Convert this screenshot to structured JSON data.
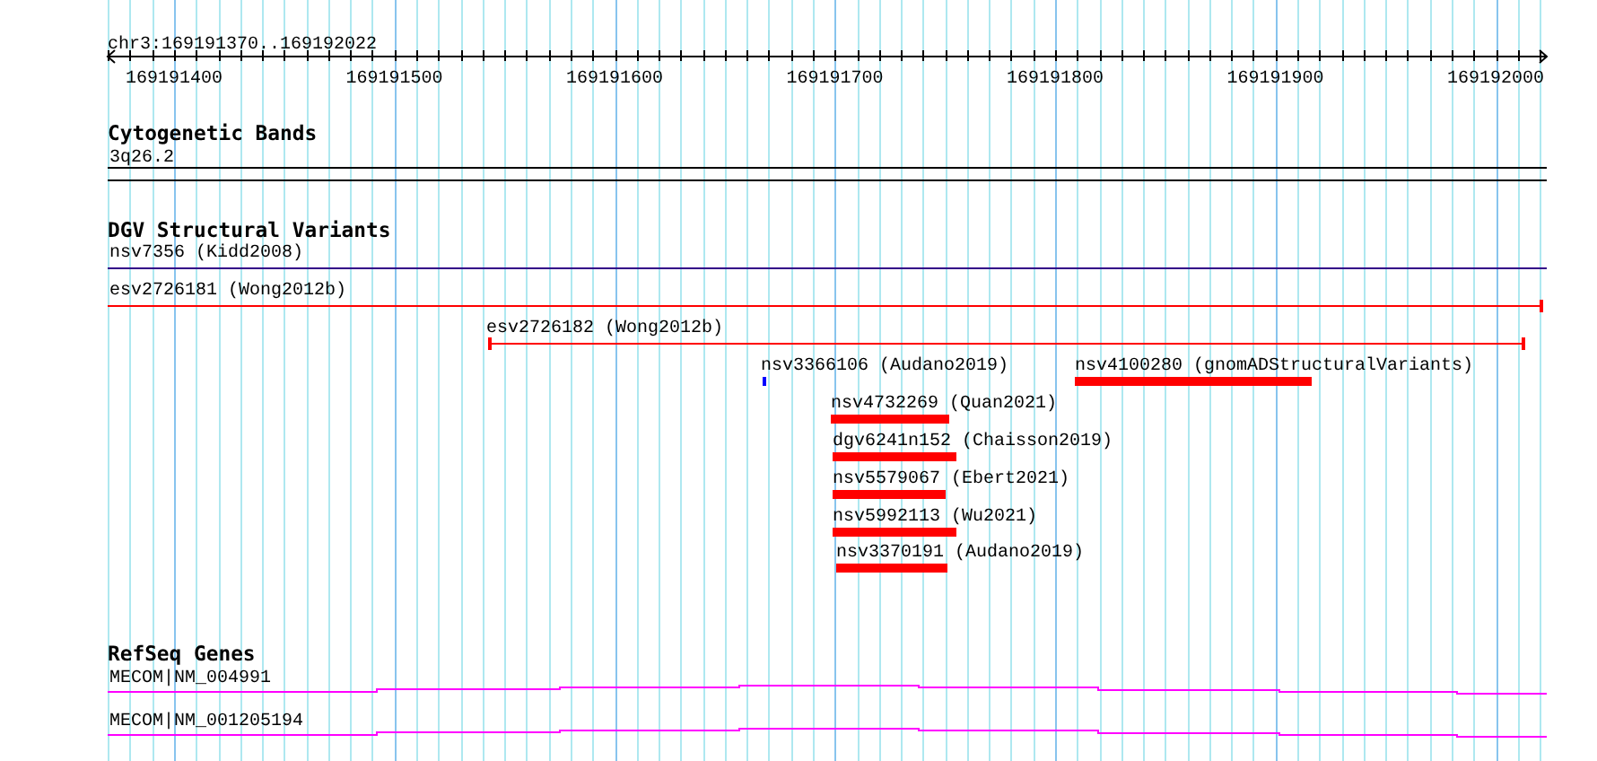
{
  "ruler": {
    "region": "chr3:169191370..169192022",
    "ticks": [
      "169191400",
      "169191500",
      "169191600",
      "169191700",
      "169191800",
      "169191900",
      "169192000"
    ]
  },
  "tracks": [
    {
      "title": "Cytogenetic Bands",
      "features": [
        {
          "label": "3q26.2",
          "kind": "band",
          "color": "#000000"
        }
      ]
    },
    {
      "title": "DGV Structural Variants",
      "features": [
        {
          "label": "nsv7356 (Kidd2008)",
          "kind": "line",
          "color": "#330088"
        },
        {
          "label": "esv2726181 (Wong2012b)",
          "kind": "line",
          "color": "#ff0000"
        },
        {
          "label": "esv2726182 (Wong2012b)",
          "kind": "line",
          "color": "#ff0000"
        },
        {
          "label": "nsv3366106 (Audano2019)",
          "kind": "bar",
          "color": "#0000ff"
        },
        {
          "label": "nsv4100280 (gnomADStructuralVariants)",
          "kind": "bar",
          "color": "#ff0000"
        },
        {
          "label": "nsv4732269 (Quan2021)",
          "kind": "bar",
          "color": "#ff0000"
        },
        {
          "label": "dgv6241n152 (Chaisson2019)",
          "kind": "bar",
          "color": "#ff0000"
        },
        {
          "label": "nsv5579067 (Ebert2021)",
          "kind": "bar",
          "color": "#ff0000"
        },
        {
          "label": "nsv5992113 (Wu2021)",
          "kind": "bar",
          "color": "#ff0000"
        },
        {
          "label": "nsv3370191 (Audano2019)",
          "kind": "bar",
          "color": "#ff0000"
        }
      ]
    },
    {
      "title": "RefSeq Genes",
      "features": [
        {
          "label": "MECOM|NM_004991",
          "kind": "gene",
          "color": "#ff00ff"
        },
        {
          "label": "MECOM|NM_001205194",
          "kind": "gene",
          "color": "#ff00ff"
        }
      ]
    }
  ]
}
